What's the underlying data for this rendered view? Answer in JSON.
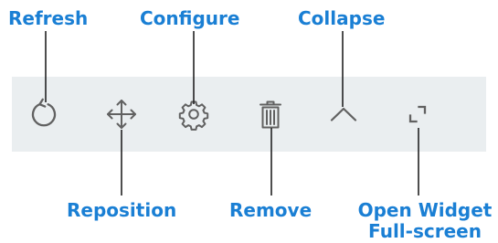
{
  "callouts": {
    "refresh": "Refresh",
    "configure": "Configure",
    "collapse": "Collapse",
    "reposition": "Reposition",
    "remove": "Remove",
    "open_widget_line1": "Open Widget",
    "open_widget_line2": "Full-screen"
  },
  "toolbar": {
    "buttons": [
      {
        "id": "refresh",
        "icon": "refresh-icon"
      },
      {
        "id": "reposition",
        "icon": "move-icon"
      },
      {
        "id": "configure",
        "icon": "gear-icon"
      },
      {
        "id": "remove",
        "icon": "trash-icon"
      },
      {
        "id": "collapse",
        "icon": "chevron-up-icon"
      },
      {
        "id": "fullscreen",
        "icon": "expand-icon"
      }
    ]
  },
  "colors": {
    "label": "#1a7fd4",
    "toolbar_bg": "#eaeef0",
    "icon": "#616161",
    "callout_line": "#222222"
  }
}
